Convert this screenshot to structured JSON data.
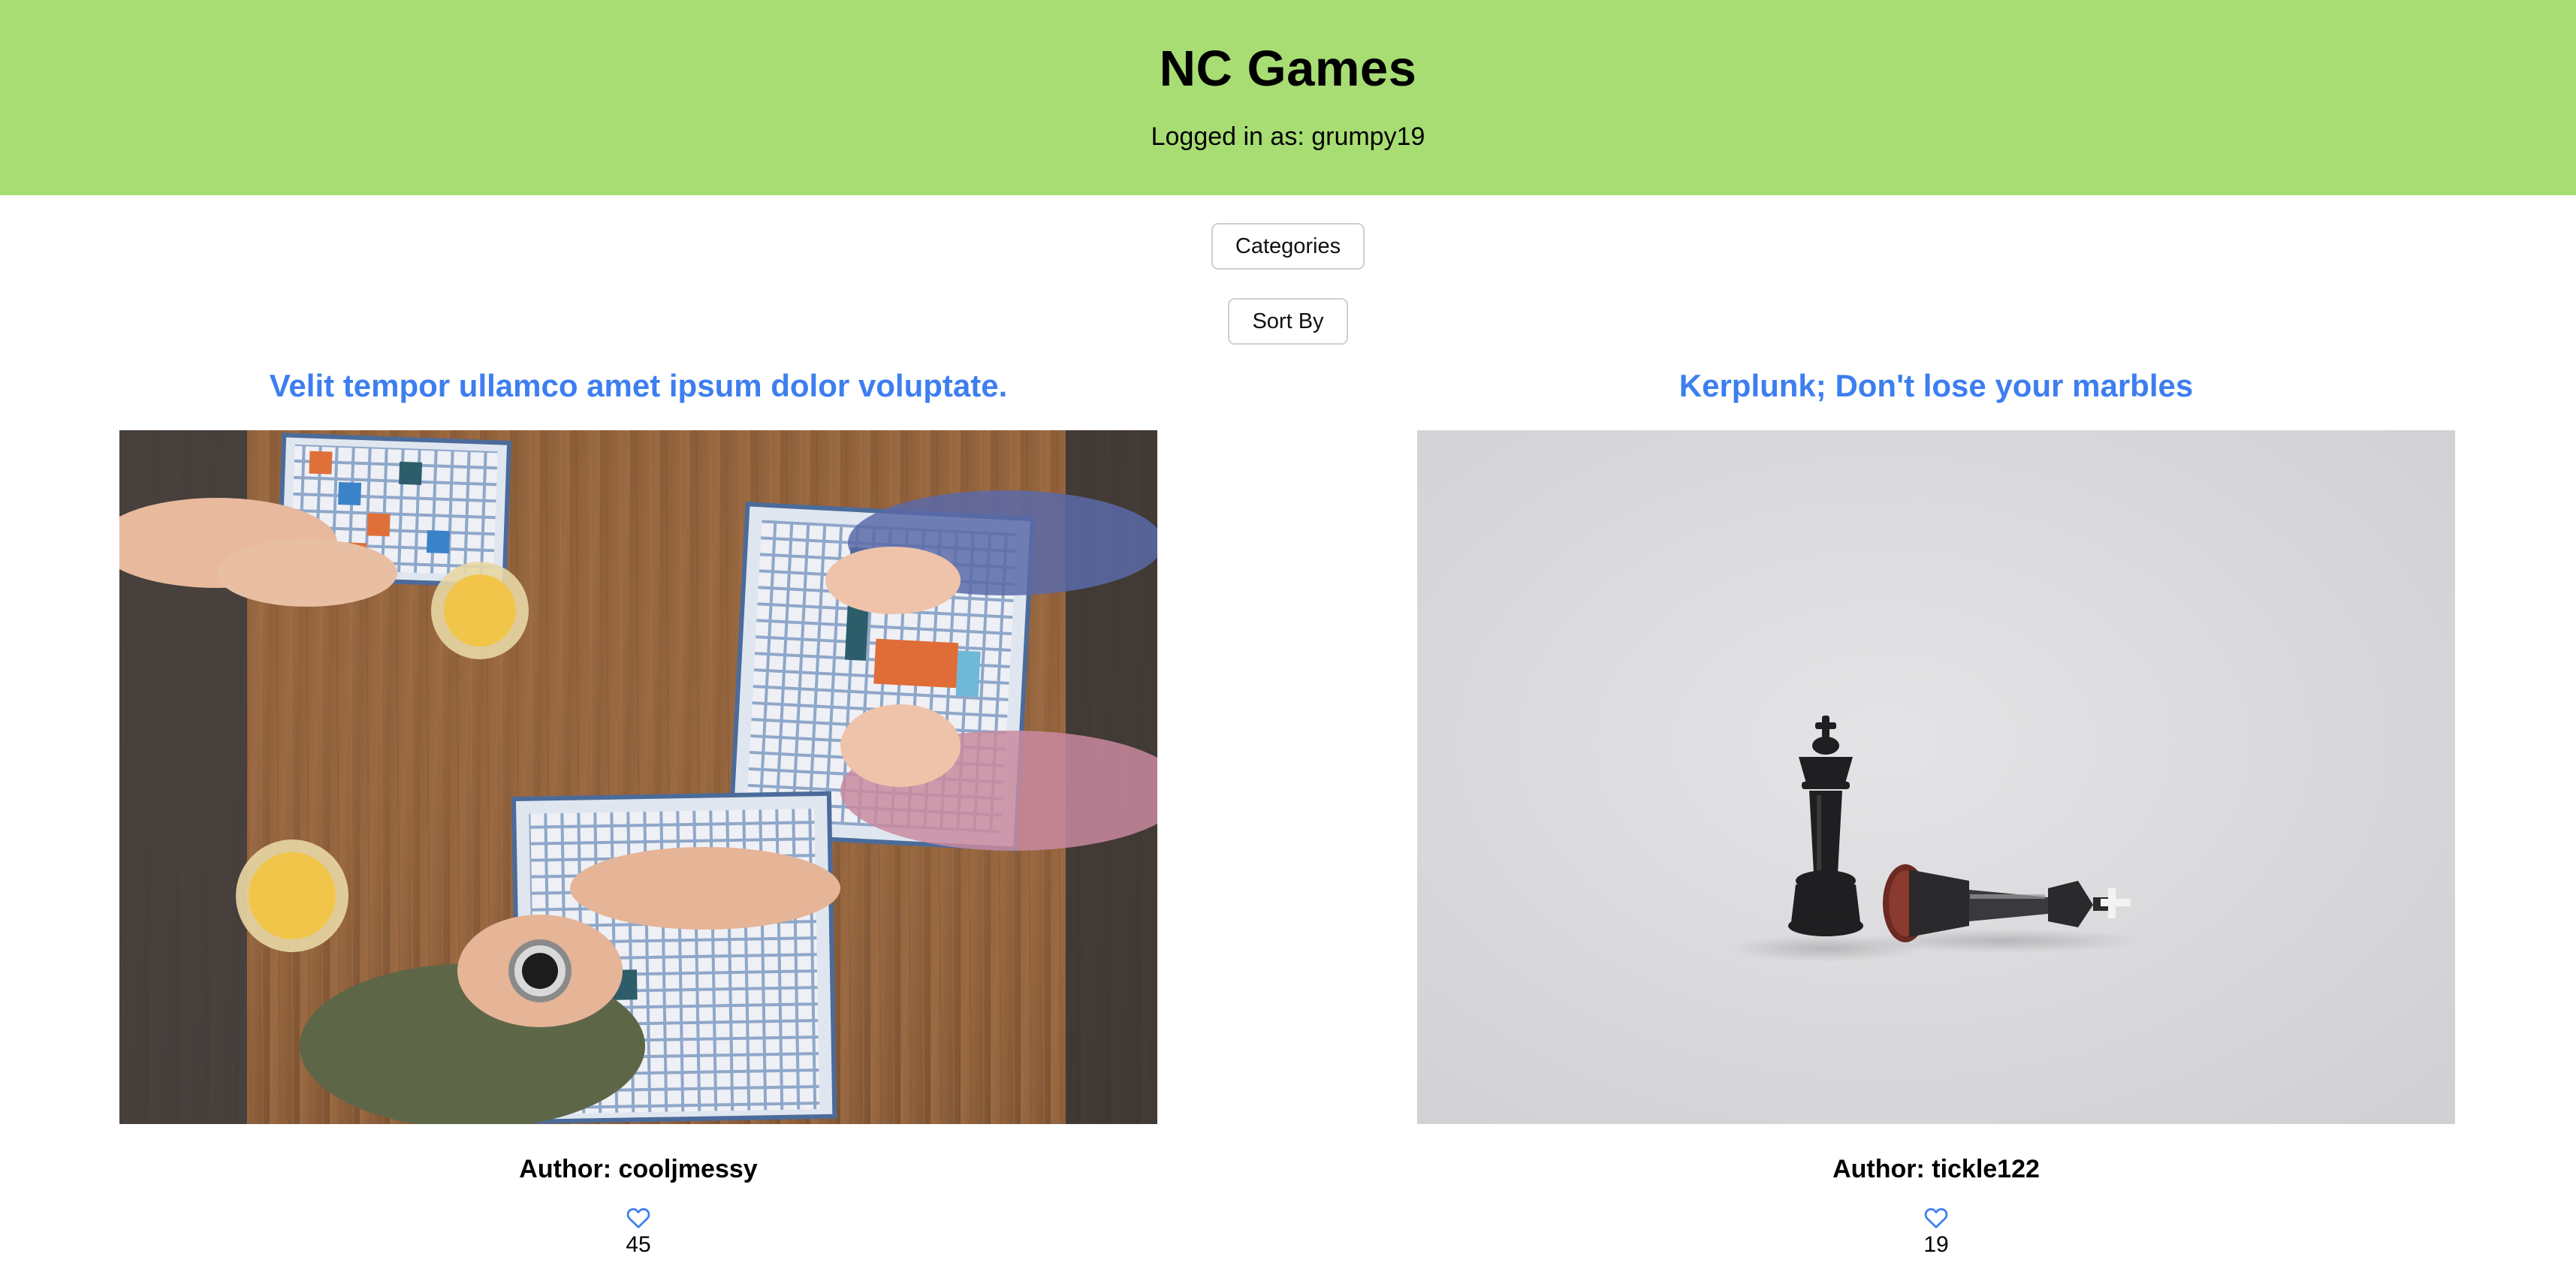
{
  "header": {
    "title": "NC Games",
    "logged_in_text": "Logged in as: grumpy19"
  },
  "controls": {
    "categories_label": "Categories",
    "sort_by_label": "Sort By"
  },
  "reviews": [
    {
      "title": "Velit tempor ullamco amet ipsum dolor voluptate.",
      "author": "Author: cooljmessy",
      "votes": "45",
      "image": "people-playing-tile-board-game-photo"
    },
    {
      "title": "Kerplunk; Don't lose your marbles",
      "author": "Author: tickle122",
      "votes": "19",
      "image": "chess-pieces-king-fallen-photo"
    }
  ],
  "icons": {
    "like": "heart-outline-icon"
  },
  "colors": {
    "header_bg": "#a8dd74",
    "title_link": "#3d7ef0",
    "heart": "#3d7ef0"
  }
}
